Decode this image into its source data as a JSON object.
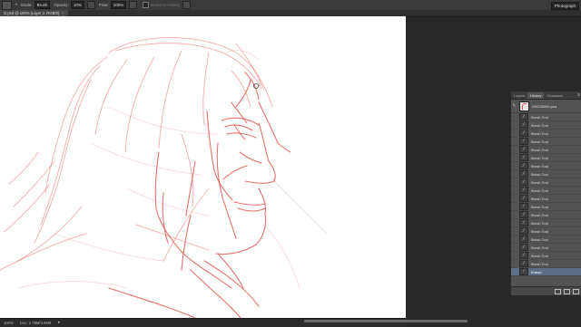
{
  "options_bar": {
    "mode_label": "Mode:",
    "mode_value": "Brush",
    "opacity_label": "Opacity:",
    "opacity_value": "10%",
    "flow_label": "Flow:",
    "flow_value": "100%",
    "erase_history_label": "Erase to History"
  },
  "workspace": "Photograph",
  "document_tab": {
    "title": "G.psd @ 100% (Layer 2, RGB/8)",
    "close": "×"
  },
  "status_bar": {
    "zoom": "100%",
    "doc_info": "Doc: 2.78M/4.88M",
    "arrow": "▸"
  },
  "history_panel": {
    "tabs": [
      "Layers",
      "History",
      "Character"
    ],
    "active_tab": "History",
    "snapshot_name": "DSC00000.psd",
    "steps": [
      "Brush Tool",
      "Brush Tool",
      "Brush Tool",
      "Brush Tool",
      "Brush Tool",
      "Brush Tool",
      "Brush Tool",
      "Brush Tool",
      "Brush Tool",
      "Brush Tool",
      "Brush Tool",
      "Brush Tool",
      "Brush Tool",
      "Brush Tool",
      "Brush Tool",
      "Brush Tool",
      "Brush Tool",
      "Brush Tool",
      "Brush Tool",
      "Eraser"
    ],
    "current_step_index": 19,
    "highlight_color": "#5d6f86"
  },
  "colors": {
    "sketch_stroke": "#e25a52",
    "canvas_bg": "#ffffff",
    "workspace_bg": "#282828"
  }
}
